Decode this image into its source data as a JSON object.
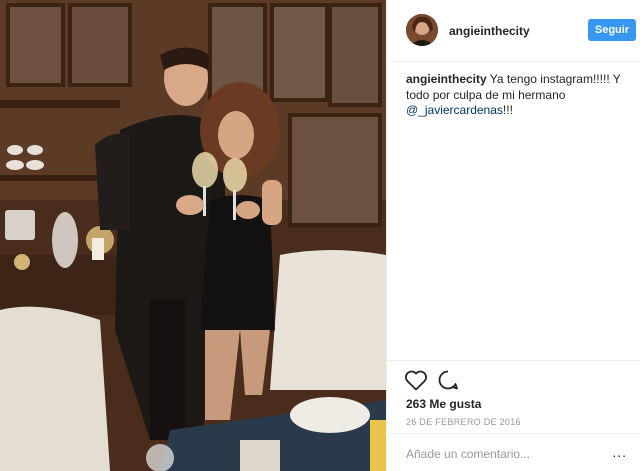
{
  "post": {
    "username": "angieinthecity",
    "follow_label": "Seguir",
    "caption": {
      "username": "angieinthecity",
      "text_before": " Ya tengo instagram!!!!! Y todo por culpa de mi hermano ",
      "mention": "@_javiercardenas",
      "text_after": "!!!"
    },
    "likes": "263 Me gusta",
    "date": "26 DE FEBRERO DE 2016",
    "comment_placeholder": "Añade un comentario...",
    "more_label": "..."
  },
  "colors": {
    "accent": "#3897f0",
    "mention": "#003569",
    "muted": "#999999",
    "border": "#efefef"
  },
  "icons": {
    "like": "heart-icon",
    "comment": "comment-icon",
    "more": "more-options-icon"
  }
}
